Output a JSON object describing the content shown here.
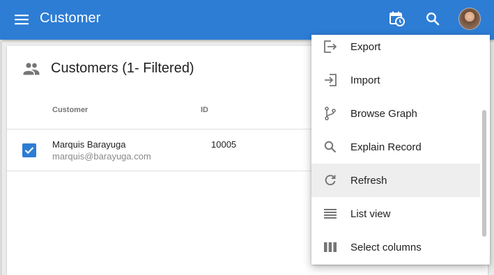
{
  "appbar": {
    "title": "Customer",
    "menu_icon": "menu-icon",
    "calendar_icon": "calendar-clock-icon",
    "search_icon": "search-icon",
    "accent_color": "#2d7dd5"
  },
  "card": {
    "header_icon": "people-icon",
    "title": "Customers (1- Filtered)",
    "columns": [
      "Customer",
      "ID"
    ],
    "rows": [
      {
        "selected": true,
        "name": "Marquis Barayuga",
        "email": "marquis@barayuga.com",
        "id": "10005"
      }
    ]
  },
  "menu": {
    "items": [
      {
        "label": "Export",
        "icon": "export-icon"
      },
      {
        "label": "Import",
        "icon": "import-icon"
      },
      {
        "label": "Browse Graph",
        "icon": "graph-branch-icon"
      },
      {
        "label": "Explain Record",
        "icon": "search-icon"
      },
      {
        "label": "Refresh",
        "icon": "refresh-icon",
        "highlighted": true
      },
      {
        "label": "List view",
        "icon": "list-icon"
      },
      {
        "label": "Select columns",
        "icon": "columns-icon"
      }
    ]
  }
}
